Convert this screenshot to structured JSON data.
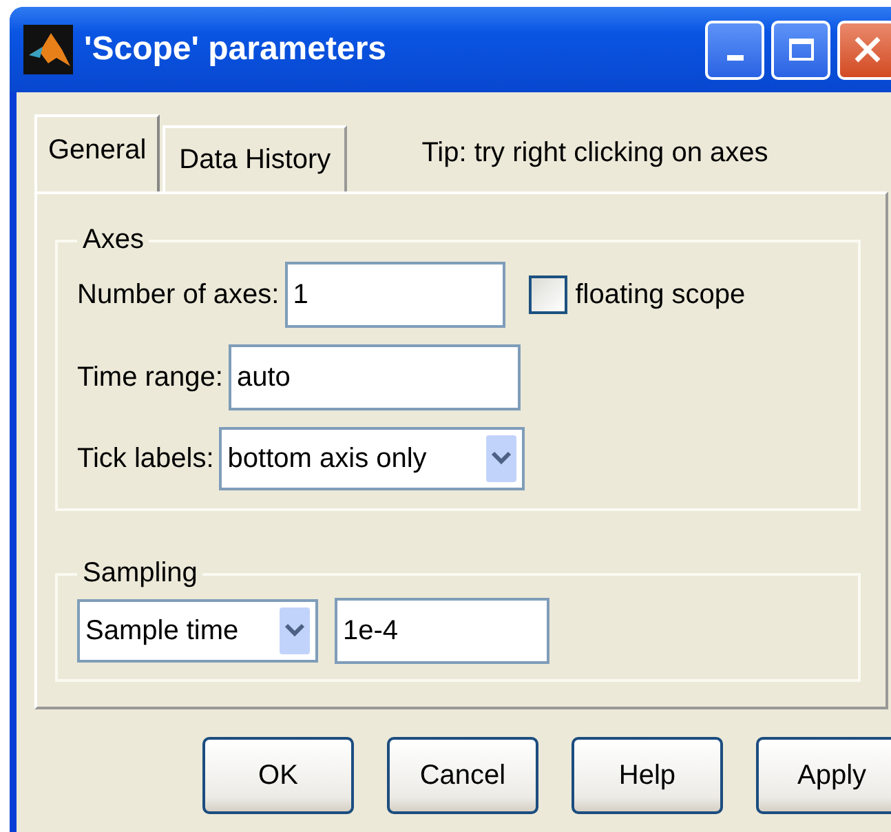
{
  "window": {
    "title": "'Scope' parameters"
  },
  "tabs": [
    {
      "label": "General",
      "selected": true
    },
    {
      "label": "Data History",
      "selected": false
    }
  ],
  "tip": "Tip: try right clicking on axes",
  "axes": {
    "title": "Axes",
    "number_of_axes": {
      "label": "Number of axes:",
      "value": "1"
    },
    "floating_scope": {
      "label": "floating scope",
      "checked": false
    },
    "time_range": {
      "label": "Time range:",
      "value": "auto"
    },
    "tick_labels": {
      "label": "Tick labels:",
      "value": "bottom axis only"
    }
  },
  "sampling": {
    "title": "Sampling",
    "mode": "Sample time",
    "value": "1e-4"
  },
  "buttons": [
    "OK",
    "Cancel",
    "Help",
    "Apply"
  ]
}
